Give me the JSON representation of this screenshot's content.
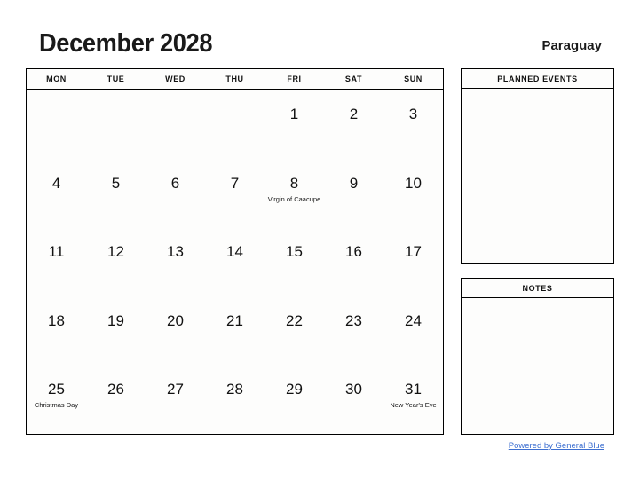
{
  "header": {
    "month_title": "December 2028",
    "country": "Paraguay"
  },
  "calendar": {
    "weekdays": [
      "MON",
      "TUE",
      "WED",
      "THU",
      "FRI",
      "SAT",
      "SUN"
    ],
    "weeks": [
      [
        {
          "day": "",
          "event": ""
        },
        {
          "day": "",
          "event": ""
        },
        {
          "day": "",
          "event": ""
        },
        {
          "day": "",
          "event": ""
        },
        {
          "day": "1",
          "event": ""
        },
        {
          "day": "2",
          "event": ""
        },
        {
          "day": "3",
          "event": ""
        }
      ],
      [
        {
          "day": "4",
          "event": ""
        },
        {
          "day": "5",
          "event": ""
        },
        {
          "day": "6",
          "event": ""
        },
        {
          "day": "7",
          "event": ""
        },
        {
          "day": "8",
          "event": "Virgin of Caacupe"
        },
        {
          "day": "9",
          "event": ""
        },
        {
          "day": "10",
          "event": ""
        }
      ],
      [
        {
          "day": "11",
          "event": ""
        },
        {
          "day": "12",
          "event": ""
        },
        {
          "day": "13",
          "event": ""
        },
        {
          "day": "14",
          "event": ""
        },
        {
          "day": "15",
          "event": ""
        },
        {
          "day": "16",
          "event": ""
        },
        {
          "day": "17",
          "event": ""
        }
      ],
      [
        {
          "day": "18",
          "event": ""
        },
        {
          "day": "19",
          "event": ""
        },
        {
          "day": "20",
          "event": ""
        },
        {
          "day": "21",
          "event": ""
        },
        {
          "day": "22",
          "event": ""
        },
        {
          "day": "23",
          "event": ""
        },
        {
          "day": "24",
          "event": ""
        }
      ],
      [
        {
          "day": "25",
          "event": "Christmas Day"
        },
        {
          "day": "26",
          "event": ""
        },
        {
          "day": "27",
          "event": ""
        },
        {
          "day": "28",
          "event": ""
        },
        {
          "day": "29",
          "event": ""
        },
        {
          "day": "30",
          "event": ""
        },
        {
          "day": "31",
          "event": "New Year's Eve"
        }
      ]
    ]
  },
  "panels": {
    "planned_events_title": "PLANNED EVENTS",
    "notes_title": "NOTES"
  },
  "footer": {
    "link_text": "Powered by General Blue",
    "link_color": "#3d6fd0"
  }
}
